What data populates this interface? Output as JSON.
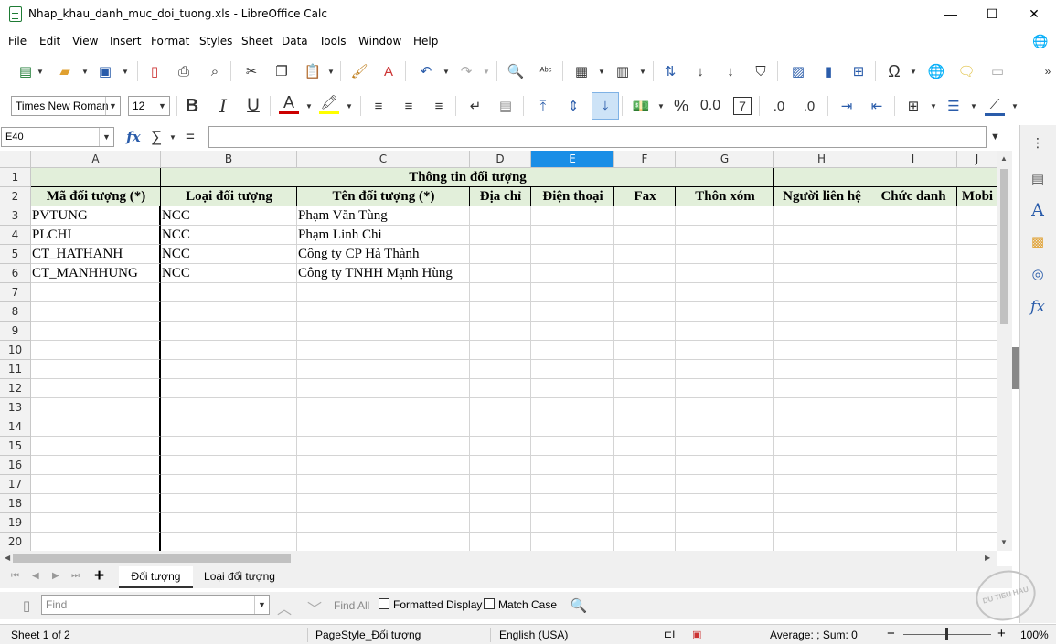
{
  "window": {
    "title": "Nhap_khau_danh_muc_doi_tuong.xls - LibreOffice Calc",
    "minimize": "—",
    "maximize": "☐",
    "close": "✕"
  },
  "menu": [
    "File",
    "Edit",
    "View",
    "Insert",
    "Format",
    "Styles",
    "Sheet",
    "Data",
    "Tools",
    "Window",
    "Help"
  ],
  "format_toolbar": {
    "font_name": "Times New Roman",
    "font_size": "12"
  },
  "formula_bar": {
    "name_box": "E40",
    "formula": ""
  },
  "columns": [
    "A",
    "B",
    "C",
    "D",
    "E",
    "F",
    "G",
    "H",
    "I",
    "J"
  ],
  "selected_column": "E",
  "rows": [
    "1",
    "2",
    "3",
    "4",
    "5",
    "6",
    "7",
    "8",
    "9",
    "10",
    "11",
    "12",
    "13",
    "14",
    "15",
    "16",
    "17",
    "18",
    "19",
    "20"
  ],
  "sheet": {
    "merged_header": "Thông tin đối tượng",
    "headers": [
      "Mã đối tượng (*)",
      "Loại đối tượng",
      "Tên đối tượng (*)",
      "Địa chỉ",
      "Điện thoại",
      "Fax",
      "Thôn xóm",
      "Người liên hệ",
      "Chức danh",
      "Mobi"
    ],
    "data": [
      [
        "PVTUNG",
        "NCC",
        "Phạm Văn Tùng"
      ],
      [
        "PLCHI",
        "NCC",
        "Phạm Linh Chi"
      ],
      [
        "CT_HATHANH",
        "NCC",
        "Công ty CP Hà Thành"
      ],
      [
        "CT_MANHHUNG",
        "NCC",
        "Công ty TNHH Mạnh Hùng"
      ]
    ]
  },
  "tabs": [
    "Đối tượng",
    "Loại đối tượng"
  ],
  "active_tab": "Đối tượng",
  "find": {
    "placeholder": "Find",
    "find_all": "Find All",
    "formatted_display": "Formatted Display",
    "match_case": "Match Case"
  },
  "status": {
    "sheet": "Sheet 1 of 2",
    "page_style": "PageStyle_Đối tượng",
    "language": "English (USA)",
    "summary": "Average: ; Sum: 0",
    "zoom": "100%"
  },
  "watermark": "DU TIEU HAU",
  "colors": {
    "header_fill": "#e2efda",
    "selection": "#1a8ee6",
    "chrome": "#f0f0f0"
  }
}
